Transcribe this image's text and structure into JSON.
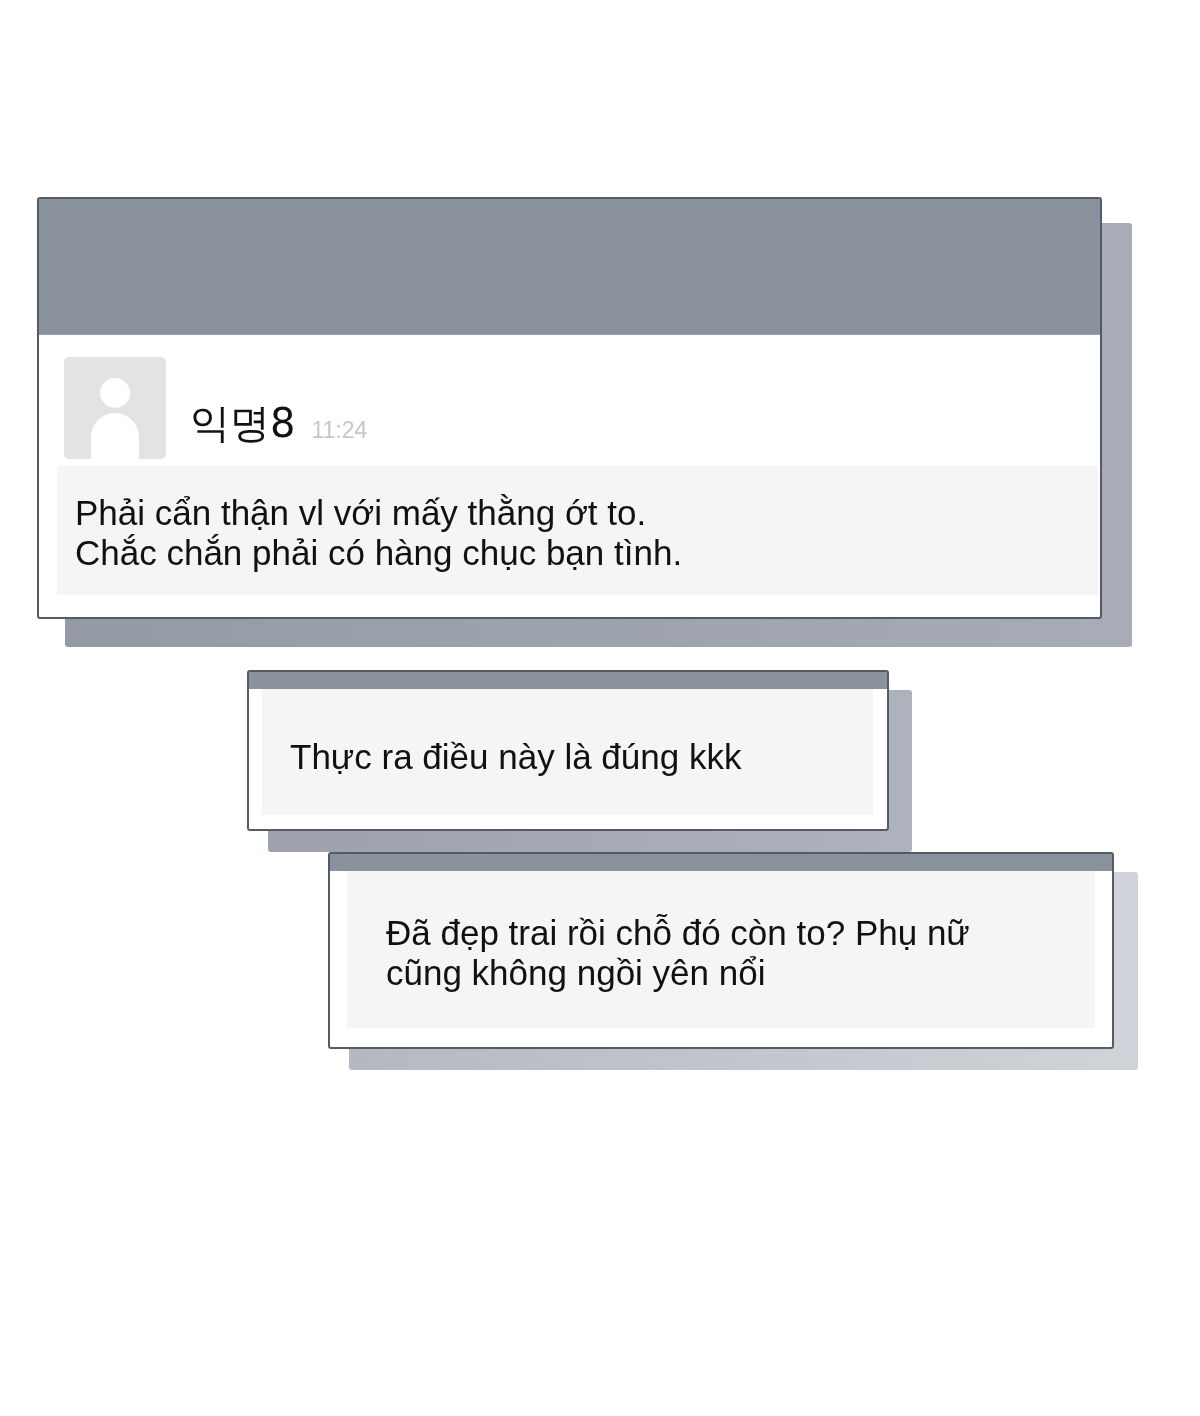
{
  "feed": [
    {
      "kind": "post",
      "author": "익명8",
      "time": "11:24",
      "text": "Phải cẩn thận vl với mấy thằng ớt to.\nChắc chắn phải có hàng chục bạn tình."
    },
    {
      "kind": "reply",
      "text": "Thực ra điều này là đúng kkk"
    },
    {
      "kind": "reply",
      "text": "Đã đẹp trai rồi chỗ đó còn to? Phụ nữ cũng không ngồi yên nổi"
    }
  ]
}
